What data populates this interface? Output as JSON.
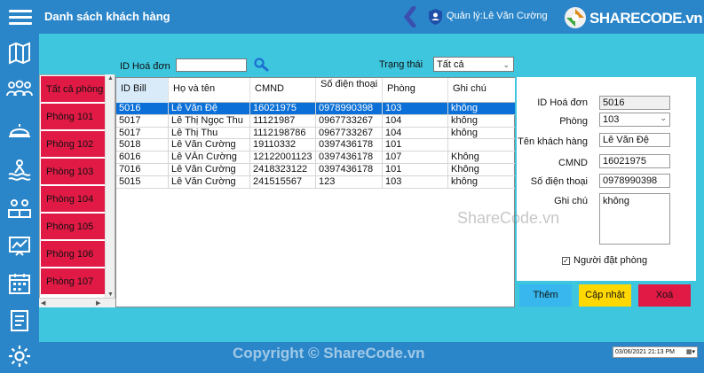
{
  "header": {
    "title": "Danh sách khách hàng",
    "user_label": "Quản lý:Lê Văn Cường",
    "logo_text": "SHARECODE.vn",
    "accent": "#2b86c9"
  },
  "sidebar": {
    "icons": [
      "map-icon",
      "customers-icon",
      "service-bell-icon",
      "beach-icon",
      "rooms-icon",
      "statistics-icon",
      "calendar-icon",
      "report-icon",
      "settings-icon"
    ]
  },
  "rooms": {
    "items": [
      "Tất cả phòng",
      "Phòng 101",
      "Phòng 102",
      "Phòng 103",
      "Phòng 104",
      "Phòng 105",
      "Phòng 106",
      "Phòng 107"
    ]
  },
  "filters": {
    "bill_id_label": "ID Hoá đơn",
    "bill_id_value": "",
    "status_label": "Trạng thái",
    "status_value": "Tất cả"
  },
  "grid": {
    "columns": [
      "ID Bill",
      "Họ và tên",
      "CMND",
      "Số điện thoại",
      "Phòng",
      "Ghi chú"
    ],
    "rows": [
      [
        "5016",
        "Lê Văn Đệ",
        "16021975",
        "0978990398",
        "103",
        "không"
      ],
      [
        "5017",
        "Lê Thị Ngọc Thu",
        "11121987",
        "0967733267",
        "104",
        "không"
      ],
      [
        "5017",
        "Lê Thị  Thu",
        "1112198786",
        "0967733267",
        "104",
        "không"
      ],
      [
        "5018",
        "Lê Văn Cường",
        "19110332",
        "0397436178",
        "101",
        ""
      ],
      [
        "6016",
        "Lê VĂn Cường",
        "12122001123",
        "0397436178",
        "107",
        "Không"
      ],
      [
        "7016",
        "Lê Văn Cường",
        "2418323122",
        "0397436178",
        "101",
        "Không"
      ],
      [
        "5015",
        "Lê Văn Cường",
        "241515567",
        "123",
        "103",
        "không"
      ]
    ]
  },
  "detail": {
    "bill_id_label": "ID Hoá đơn",
    "bill_id_value": "5016",
    "room_label": "Phòng",
    "room_value": "103",
    "customer_label": "Tên khách hàng",
    "customer_value": "Lê Văn Đệ",
    "id_card_label": "CMND",
    "id_card_value": "16021975",
    "phone_label": "Số điện thoại",
    "phone_value": "0978990398",
    "note_label": "Ghi chú",
    "note_value": "không",
    "booker_label": "Người đặt phòng"
  },
  "actions": {
    "add_label": "Thêm",
    "update_label": "Cập nhật",
    "delete_label": "Xoá",
    "add_color": "#37b7ee",
    "update_color": "#ffd800",
    "delete_color": "#e01a45"
  },
  "watermarks": {
    "center": "ShareCode.vn",
    "bottom": "Copyright © ShareCode.vn"
  },
  "datetime": "03/06/2021 21:13 PM"
}
